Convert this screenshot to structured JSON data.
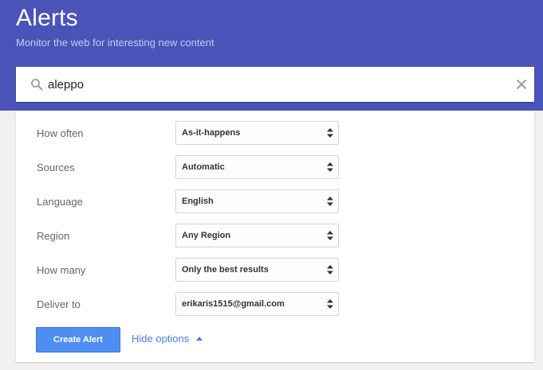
{
  "header": {
    "title": "Alerts",
    "subtitle": "Monitor the web for interesting new content"
  },
  "search": {
    "value": "aleppo",
    "search_icon": "search-icon",
    "clear_icon": "close-icon"
  },
  "options": [
    {
      "label": "How often",
      "value": "As-it-happens"
    },
    {
      "label": "Sources",
      "value": "Automatic"
    },
    {
      "label": "Language",
      "value": "English"
    },
    {
      "label": "Region",
      "value": "Any Region"
    },
    {
      "label": "How many",
      "value": "Only the best results"
    },
    {
      "label": "Deliver to",
      "value": "erikaris1515@gmail.com"
    }
  ],
  "actions": {
    "create_label": "Create Alert",
    "hide_label": "Hide options"
  },
  "colors": {
    "header_bg": "#4a54b8",
    "button_bg": "#4d8ef0",
    "link": "#4a7fd6"
  }
}
